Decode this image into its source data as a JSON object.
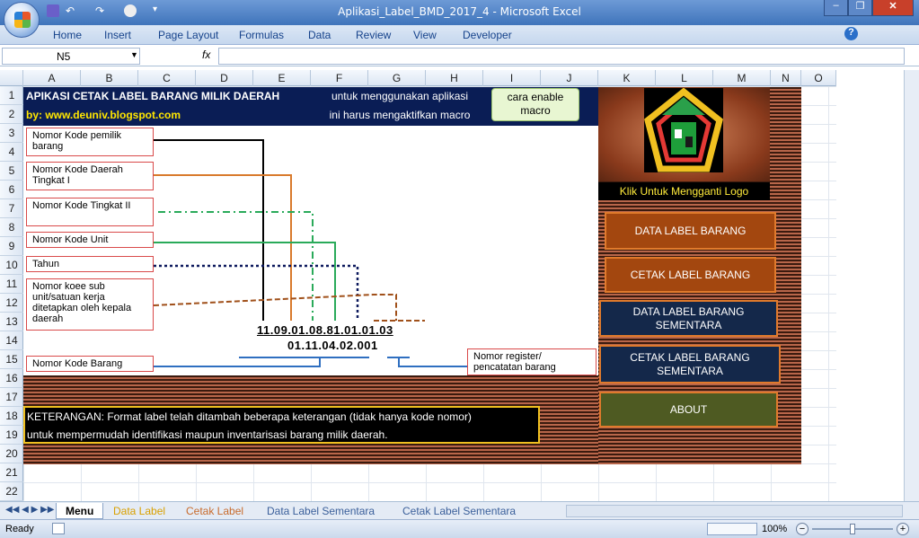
{
  "window": {
    "title": "Aplikasi_Label_BMD_2017_4  -  Microsoft Excel"
  },
  "ribbon": {
    "tabs": [
      "Home",
      "Insert",
      "Page Layout",
      "Formulas",
      "Data",
      "Review",
      "View",
      "Developer"
    ]
  },
  "formula_bar": {
    "name_box": "N5",
    "fx": "fx",
    "value": ""
  },
  "columns": [
    "A",
    "B",
    "C",
    "D",
    "E",
    "F",
    "G",
    "H",
    "I",
    "J",
    "K",
    "L",
    "M",
    "N",
    "O"
  ],
  "rows": [
    "1",
    "2",
    "3",
    "4",
    "5",
    "6",
    "7",
    "8",
    "9",
    "10",
    "11",
    "12",
    "13",
    "14",
    "15",
    "16",
    "17",
    "18",
    "19",
    "20",
    "21",
    "22"
  ],
  "sheet": {
    "title": "APIKASI CETAK LABEL BARANG MILIK DAERAH",
    "byline": "by: www.deuniv.blogspot.com",
    "info_line1": "untuk menggunakan aplikasi",
    "info_line2": "ini harus mengaktifkan macro",
    "enable_btn": "cara enable macro",
    "labels": {
      "kode_pemilik": "Nomor Kode pemilik barang",
      "kode_daerah_1": "Nomor Kode Daerah Tingkat I",
      "kode_daerah_2": "Nomor Kode Tingkat II",
      "kode_unit": "Nomor Kode Unit",
      "tahun": "Tahun",
      "sub_unit": "Nomor koee sub unit/satuan kerja ditetapkan oleh kepala daerah",
      "kode_barang": "Nomor Kode Barang",
      "register": "Nomor register/ pencatatan barang"
    },
    "code_line1": "11.09.01.08.81.01.01.03",
    "code_line2": "01.11.04.02.001",
    "keterangan_line1": "KETERANGAN: Format label telah ditambah beberapa keterangan (tidak hanya kode nomor)",
    "keterangan_line2": "untuk mempermudah identifikasi maupun inventarisasi barang milik daerah.",
    "logo_label": "Klik Untuk Mengganti Logo",
    "buttons": {
      "data_label": "DATA LABEL BARANG",
      "cetak_label": "CETAK LABEL BARANG",
      "data_sementara": "DATA LABEL BARANG SEMENTARA",
      "cetak_sementara": "CETAK LABEL BARANG SEMENTARA",
      "about": "ABOUT"
    }
  },
  "sheet_tabs": [
    "Menu",
    "Data Label",
    "Cetak Label",
    "Data Label Sementara",
    "Cetak Label Sementara"
  ],
  "status": {
    "ready": "Ready",
    "zoom": "100%"
  }
}
